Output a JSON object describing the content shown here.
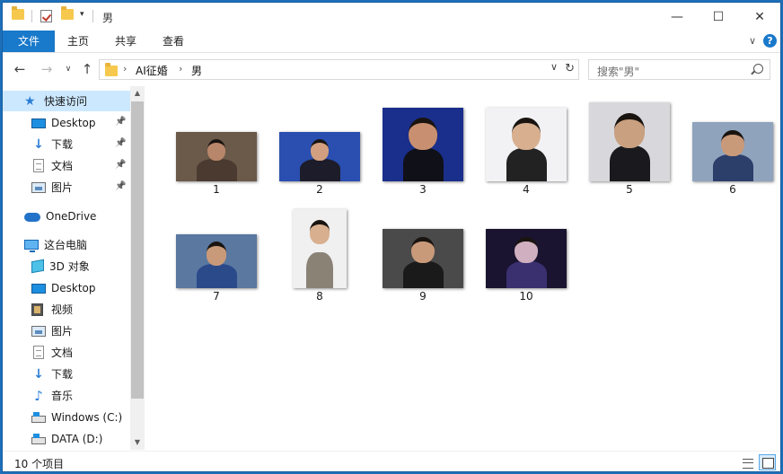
{
  "titlebar": {
    "title": "男",
    "quick_access_icons": [
      "folder-icon",
      "properties-icon",
      "new-folder-icon",
      "customize-dropdown-icon"
    ],
    "minimize": "minimize-icon",
    "maximize": "maximize-icon",
    "close": "close-icon"
  },
  "ribbon": {
    "tabs": [
      {
        "label": "文件"
      },
      {
        "label": "主页"
      },
      {
        "label": "共享"
      },
      {
        "label": "查看"
      }
    ]
  },
  "address": {
    "crumbs": [
      "AI征婚",
      "男"
    ],
    "search_placeholder": "搜索\"男\""
  },
  "navpane": {
    "items": [
      {
        "label": "快速访问",
        "icon": "star-icon",
        "pinned": false,
        "selected": true
      },
      {
        "label": "Desktop",
        "icon": "desktop-icon",
        "pinned": true
      },
      {
        "label": "下载",
        "icon": "download-icon",
        "pinned": true
      },
      {
        "label": "文档",
        "icon": "document-icon",
        "pinned": true
      },
      {
        "label": "图片",
        "icon": "picture-icon",
        "pinned": true
      },
      {
        "label": "OneDrive",
        "icon": "cloud-icon",
        "pinned": false
      },
      {
        "label": "这台电脑",
        "icon": "pc-icon",
        "pinned": false
      },
      {
        "label": "3D 对象",
        "icon": "3d-objects-icon",
        "pinned": false
      },
      {
        "label": "Desktop",
        "icon": "desktop-icon",
        "pinned": false
      },
      {
        "label": "视频",
        "icon": "video-icon",
        "pinned": false
      },
      {
        "label": "图片",
        "icon": "picture-icon",
        "pinned": false
      },
      {
        "label": "文档",
        "icon": "document-icon",
        "pinned": false
      },
      {
        "label": "下载",
        "icon": "download-icon",
        "pinned": false
      },
      {
        "label": "音乐",
        "icon": "music-icon",
        "pinned": false
      },
      {
        "label": "Windows (C:)",
        "icon": "drive-icon",
        "pinned": false
      },
      {
        "label": "DATA (D:)",
        "icon": "drive-icon",
        "pinned": false
      }
    ]
  },
  "files": [
    {
      "name": "1"
    },
    {
      "name": "2"
    },
    {
      "name": "3"
    },
    {
      "name": "4"
    },
    {
      "name": "5"
    },
    {
      "name": "6"
    },
    {
      "name": "7"
    },
    {
      "name": "8"
    },
    {
      "name": "9"
    },
    {
      "name": "10"
    }
  ],
  "status": {
    "item_count": "10 个项目",
    "view_modes": [
      "details-view-icon",
      "large-icons-view-icon"
    ],
    "active_view": "large-icons-view-icon"
  }
}
